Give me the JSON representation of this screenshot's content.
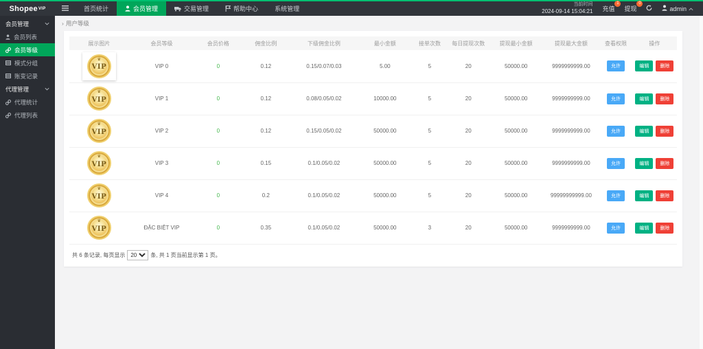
{
  "topbar": {
    "logo": "Shopee",
    "logo_sup": "VIP",
    "nav": [
      {
        "label": "首页统计"
      },
      {
        "label": "会员管理"
      },
      {
        "label": "交易管理"
      },
      {
        "label": "帮助中心"
      },
      {
        "label": "系统管理"
      }
    ],
    "time_label": "当前时间",
    "time_value": "2024-09-14 15:04:21",
    "recharge_label": "充值",
    "recharge_badge": "1",
    "withdraw_label": "提现",
    "withdraw_badge": "0",
    "username": "admin"
  },
  "sidebar": {
    "items": [
      {
        "label": "会员管理"
      },
      {
        "label": "会员列表"
      },
      {
        "label": "会员等级"
      },
      {
        "label": "模式分组"
      },
      {
        "label": "账变记录"
      },
      {
        "label": "代理管理"
      },
      {
        "label": "代理统计"
      },
      {
        "label": "代理列表"
      }
    ]
  },
  "breadcrumb": {
    "marker": "›",
    "label": "用户等级"
  },
  "table": {
    "headers": [
      "展示图片",
      "会员等级",
      "会员价格",
      "佣金比例",
      "下级佣金比例",
      "最小金额",
      "接单次数",
      "每日提现次数",
      "提现最小金额",
      "提现最大金额",
      "查看权限",
      "操作"
    ],
    "coin_text": "VIP",
    "allow_label": "允许",
    "edit_label": "编辑",
    "delete_label": "删除",
    "rows": [
      {
        "level": "VIP 0",
        "price": "0",
        "commission": "0.12",
        "sub_commission": "0.15/0.07/0.03",
        "min_amount": "5.00",
        "orders": "5",
        "daily_withdraw": "20",
        "min_withdraw": "50000.00",
        "max_withdraw": "9999999999.00"
      },
      {
        "level": "VIP 1",
        "price": "0",
        "commission": "0.12",
        "sub_commission": "0.08/0.05/0.02",
        "min_amount": "10000.00",
        "orders": "5",
        "daily_withdraw": "20",
        "min_withdraw": "50000.00",
        "max_withdraw": "9999999999.00"
      },
      {
        "level": "VIP 2",
        "price": "0",
        "commission": "0.12",
        "sub_commission": "0.15/0.05/0.02",
        "min_amount": "50000.00",
        "orders": "5",
        "daily_withdraw": "20",
        "min_withdraw": "50000.00",
        "max_withdraw": "9999999999.00"
      },
      {
        "level": "VIP 3",
        "price": "0",
        "commission": "0.15",
        "sub_commission": "0.1/0.05/0.02",
        "min_amount": "50000.00",
        "orders": "5",
        "daily_withdraw": "20",
        "min_withdraw": "50000.00",
        "max_withdraw": "9999999999.00"
      },
      {
        "level": "VIP 4",
        "price": "0",
        "commission": "0.2",
        "sub_commission": "0.1/0.05/0.02",
        "min_amount": "50000.00",
        "orders": "5",
        "daily_withdraw": "20",
        "min_withdraw": "50000.00",
        "max_withdraw": "99999999999.00"
      },
      {
        "level": "ĐẶC BIỆT VIP",
        "price": "0",
        "commission": "0.35",
        "sub_commission": "0.1/0.05/0.02",
        "min_amount": "50000.00",
        "orders": "3",
        "daily_withdraw": "20",
        "min_withdraw": "50000.00",
        "max_withdraw": "9999999999.00"
      }
    ]
  },
  "pagination": {
    "prefix": "共 6 条记录, 每页显示",
    "page_size": "20",
    "suffix": "条, 共 1 页当前显示第 1 页。"
  }
}
